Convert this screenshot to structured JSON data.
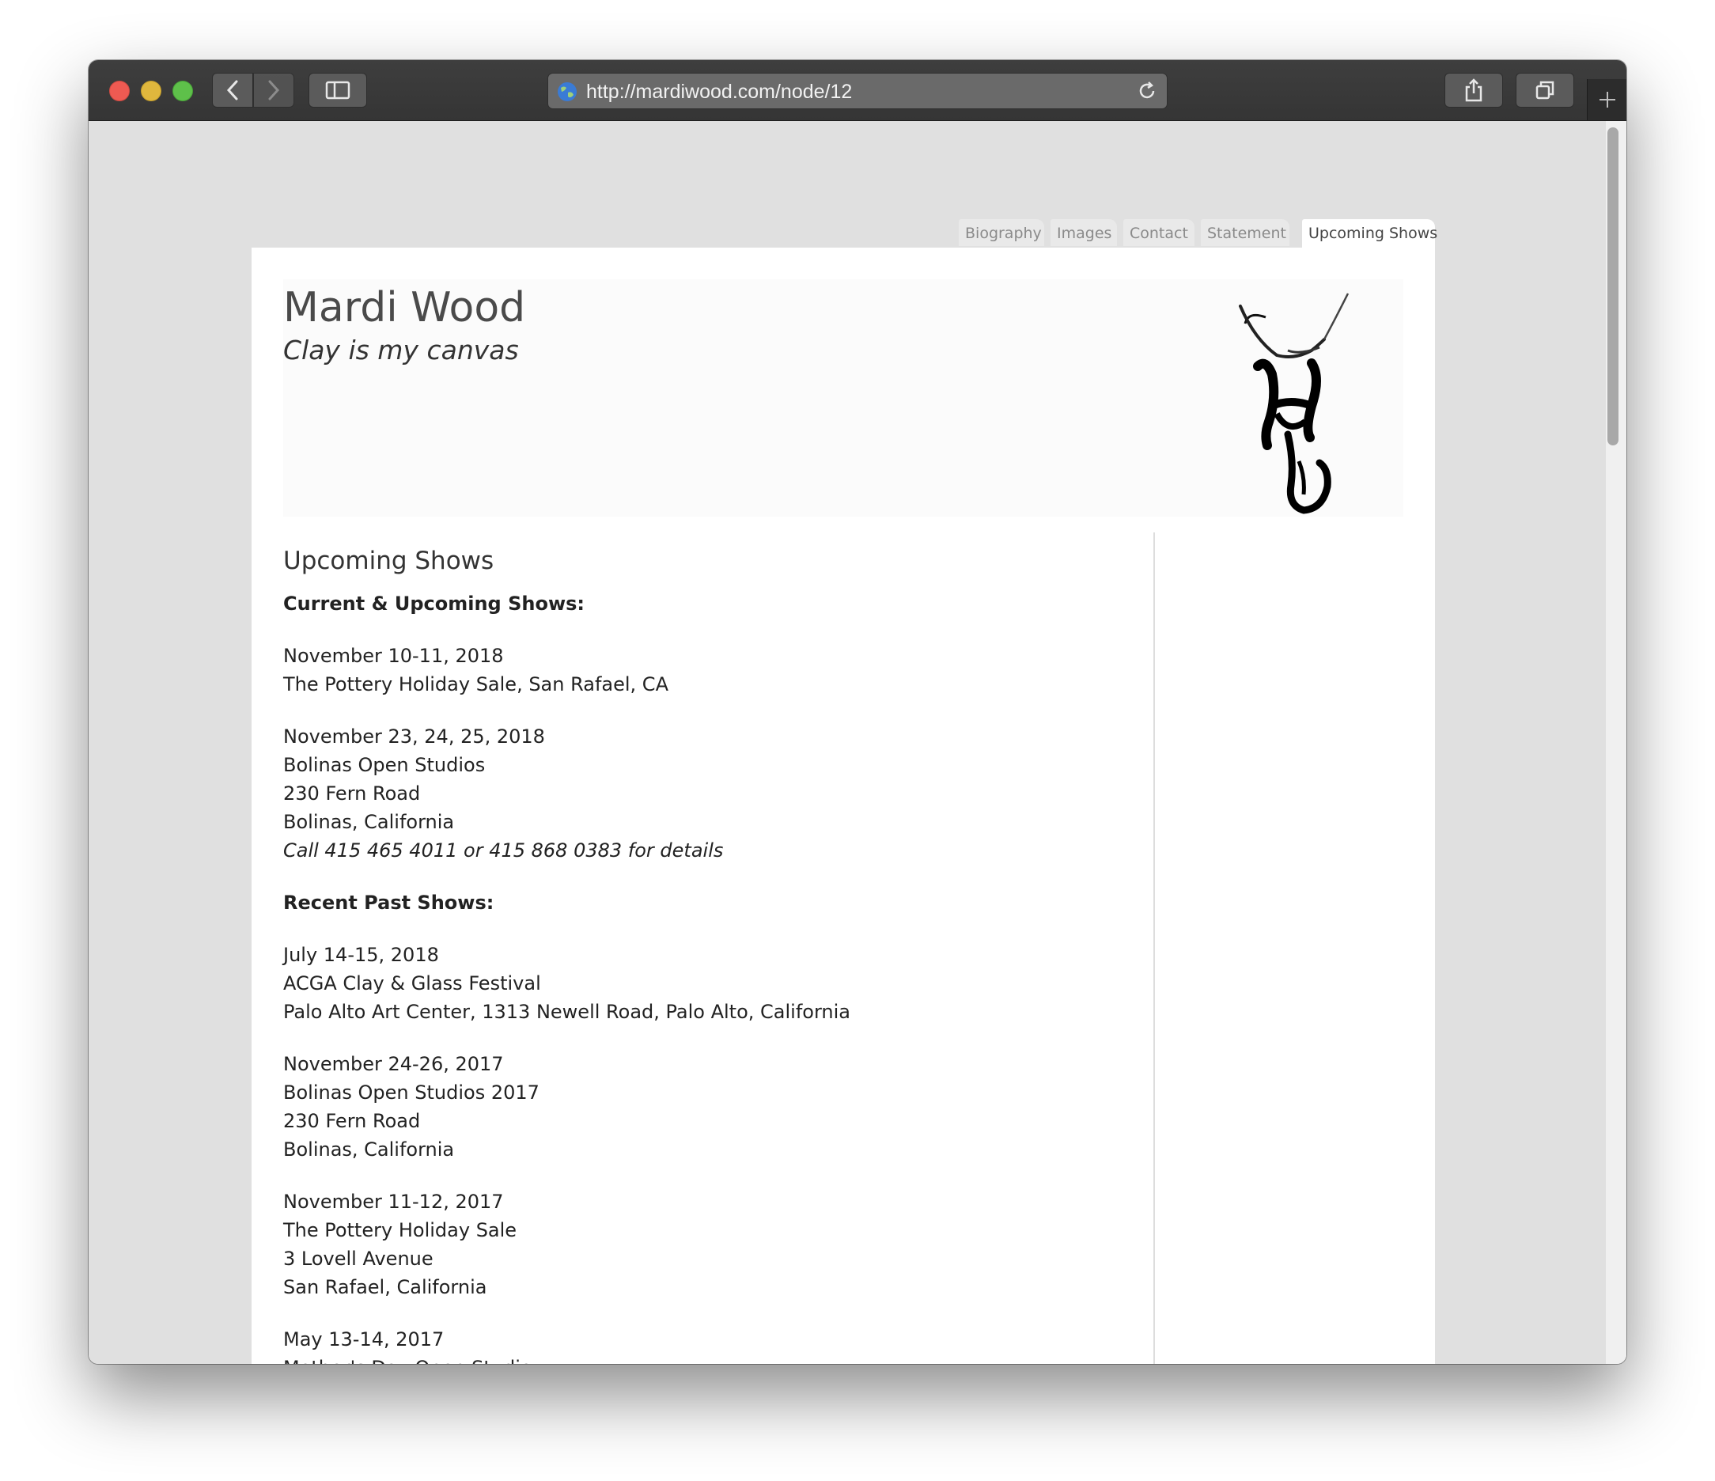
{
  "browser": {
    "url": "http://mardiwood.com/node/12"
  },
  "nav": {
    "tabs": [
      {
        "label": "Biography"
      },
      {
        "label": "Images"
      },
      {
        "label": "Contact"
      },
      {
        "label": "Statement"
      },
      {
        "label": "Upcoming Shows",
        "active": true
      }
    ]
  },
  "site": {
    "name": "Mardi Wood",
    "slogan": "Clay is my canvas"
  },
  "main": {
    "page_title": "Upcoming Shows",
    "current_heading": "Current & Upcoming Shows:",
    "current_shows": [
      {
        "lines": [
          "November 10-11, 2018",
          "The Pottery Holiday Sale, San Rafael, CA"
        ]
      },
      {
        "lines": [
          "November 23, 24, 25, 2018",
          "Bolinas Open Studios",
          "230 Fern Road",
          "Bolinas, California"
        ],
        "note": "Call 415 465 4011 or 415 868 0383 for details"
      }
    ],
    "past_heading": "Recent Past Shows:",
    "past_shows": [
      {
        "lines": [
          "July 14-15, 2018",
          "ACGA Clay & Glass Festival",
          "Palo Alto Art Center, 1313 Newell Road, Palo Alto, California"
        ]
      },
      {
        "lines": [
          "November 24-26, 2017",
          "Bolinas Open Studios 2017",
          "230 Fern Road",
          "Bolinas, California"
        ]
      },
      {
        "lines": [
          "November 11-12, 2017",
          "The Pottery Holiday Sale",
          "3 Lovell Avenue",
          "San Rafael, California"
        ]
      },
      {
        "lines": [
          "May 13-14, 2017",
          "Mother's Day Open Studio"
        ]
      }
    ]
  }
}
